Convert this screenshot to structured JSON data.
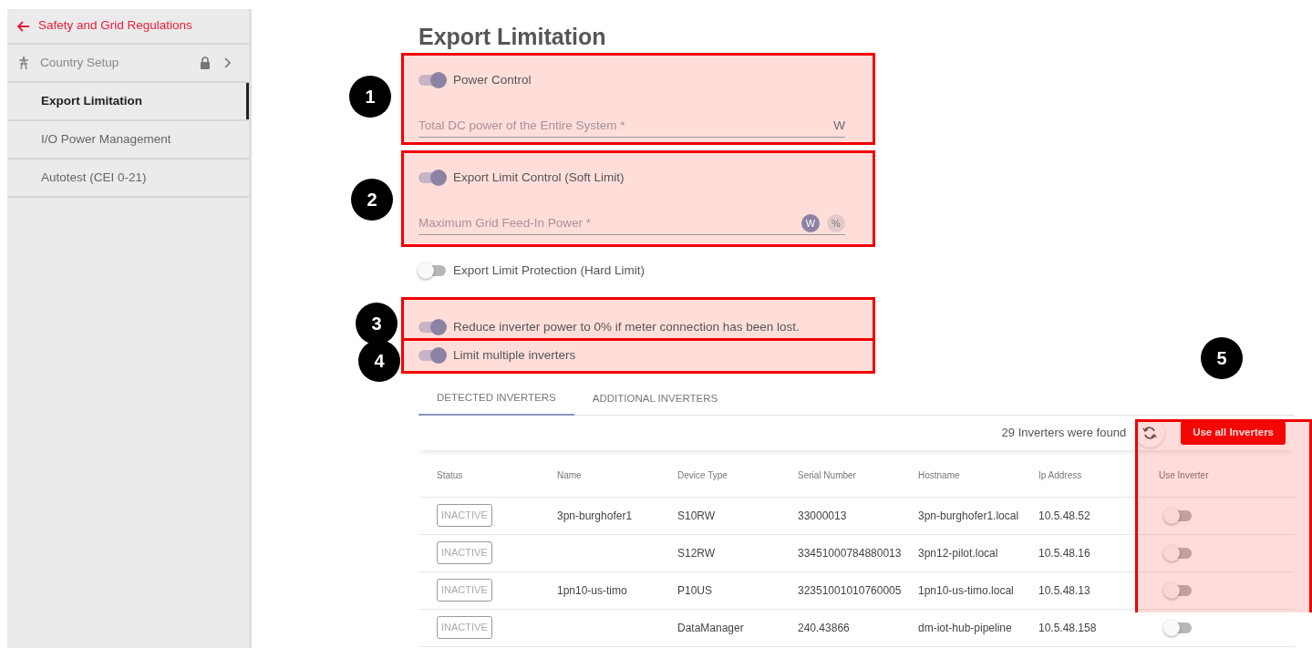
{
  "sidebar": {
    "back_link": "Safety and Grid Regulations",
    "items": [
      {
        "label": "Country Setup",
        "kind": "group",
        "locked": true,
        "selected": false
      },
      {
        "label": "Export Limitation",
        "kind": "page",
        "locked": false,
        "selected": true
      },
      {
        "label": "I/O Power Management",
        "kind": "page",
        "locked": false,
        "selected": false
      },
      {
        "label": "Autotest (CEI 0-21)",
        "kind": "page",
        "locked": false,
        "selected": false
      }
    ]
  },
  "title": "Export Limitation",
  "settings": [
    {
      "label": "Power Control",
      "on": true,
      "callout": "1",
      "field": {
        "placeholder": "Total DC power of the Entire System *",
        "unit": "W"
      }
    },
    {
      "label": "Export Limit Control (Soft Limit)",
      "on": true,
      "callout": "2",
      "field": {
        "placeholder": "Maximum Grid Feed-In Power *",
        "units": [
          {
            "label": "W",
            "selected": true
          },
          {
            "label": "%",
            "selected": false
          }
        ]
      }
    },
    {
      "label": "Export Limit Protection (Hard Limit)",
      "on": false
    },
    {
      "label": "Reduce inverter power to 0% if meter connection has been lost.",
      "on": true,
      "callout": "3"
    },
    {
      "label": "Limit multiple inverters",
      "on": true,
      "callout": "4"
    }
  ],
  "tabs": [
    {
      "label": "DETECTED INVERTERS",
      "selected": true
    },
    {
      "label": "ADDITIONAL INVERTERS",
      "selected": false
    }
  ],
  "table": {
    "found_text": "29 Inverters were found",
    "use_all_button": "Use all Inverters",
    "callout": "5",
    "columns": [
      "Status",
      "Name",
      "Device Type",
      "Serial Number",
      "Hostname",
      "Ip Address",
      "Use Inverter"
    ],
    "rows": [
      {
        "status": "INACTIVE",
        "name": "3pn-burghofer1",
        "device_type": "S10RW",
        "serial_number": "33000013",
        "hostname": "3pn-burghofer1.local",
        "ip_address": "10.5.48.52",
        "use_inverter": false
      },
      {
        "status": "INACTIVE",
        "device_type": "S12RW",
        "serial_number": "33451000784880013",
        "hostname": "3pn12-pilot.local",
        "ip_address": "10.5.48.16",
        "use_inverter": false
      },
      {
        "status": "INACTIVE",
        "name": "1pn10-us-timo",
        "device_type": "P10US",
        "serial_number": "32351001010760005",
        "hostname": "1pn10-us-timo.local",
        "ip_address": "10.5.48.13",
        "use_inverter": false
      },
      {
        "status": "INACTIVE",
        "device_type": "DataManager",
        "serial_number": "240.43866",
        "hostname": "dm-iot-hub-pipeline",
        "ip_address": "10.5.48.158",
        "use_inverter": false
      }
    ]
  }
}
